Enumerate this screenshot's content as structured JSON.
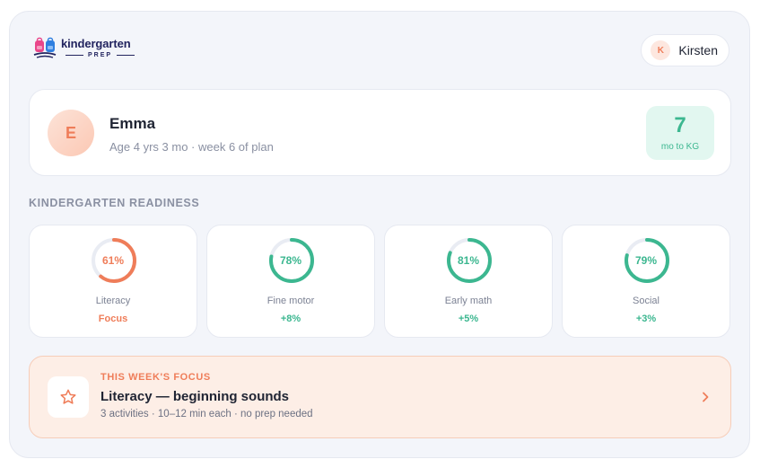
{
  "brand": {
    "name": "kindergarten",
    "sub": "PREP"
  },
  "user": {
    "initial": "K",
    "name": "Kirsten"
  },
  "child": {
    "initial": "E",
    "name": "Emma",
    "meta": "Age 4 yrs 3 mo · week 6 of plan",
    "countdown_value": "7",
    "countdown_label": "mo to KG"
  },
  "readiness": {
    "title": "KINDERGARTEN READINESS",
    "metrics": [
      {
        "pct_label": "61%",
        "value": 61,
        "label": "Literacy",
        "delta": "Focus",
        "color": "#ef7d59"
      },
      {
        "pct_label": "78%",
        "value": 78,
        "label": "Fine motor",
        "delta": "+8%",
        "color": "#3cb790"
      },
      {
        "pct_label": "81%",
        "value": 81,
        "label": "Early math",
        "delta": "+5%",
        "color": "#3cb790"
      },
      {
        "pct_label": "79%",
        "value": 79,
        "label": "Social",
        "delta": "+3%",
        "color": "#3cb790"
      }
    ]
  },
  "focus": {
    "kicker": "THIS WEEK'S FOCUS",
    "title": "Literacy — beginning sounds",
    "sub": "3 activities · 10–12 min each · no prep needed",
    "icon": "star-icon"
  },
  "colors": {
    "accent_orange": "#ef7d59",
    "accent_green": "#3cb790",
    "brand_navy": "#22245f"
  }
}
